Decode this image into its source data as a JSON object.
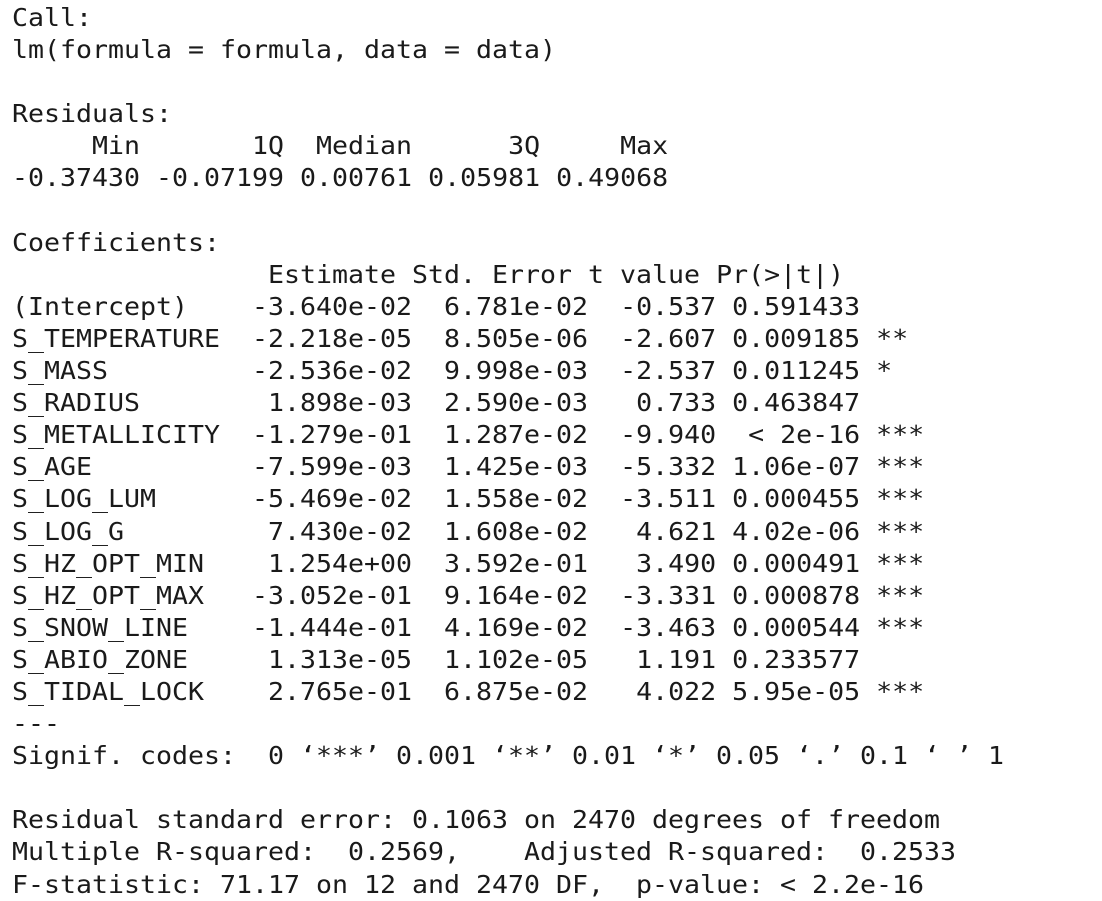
{
  "console": {
    "call_label": "Call:",
    "call": "lm(formula = formula, data = data)",
    "residuals_label": "Residuals:",
    "residual_headers": [
      "Min",
      "1Q",
      "Median",
      "3Q",
      "Max"
    ],
    "residual_values": [
      "-0.37430",
      "-0.07199",
      "0.00761",
      "0.05981",
      "0.49068"
    ],
    "coefficients_label": "Coefficients:",
    "coef_headers": [
      "Estimate",
      "Std. Error",
      "t value",
      "Pr(>|t|)"
    ],
    "coef_rows": [
      {
        "term": "(Intercept)",
        "estimate": "-3.640e-02",
        "std_error": "6.781e-02",
        "t_value": "-0.537",
        "p_value": "0.591433",
        "signif": ""
      },
      {
        "term": "S_TEMPERATURE",
        "estimate": "-2.218e-05",
        "std_error": "8.505e-06",
        "t_value": "-2.607",
        "p_value": "0.009185",
        "signif": "**"
      },
      {
        "term": "S_MASS",
        "estimate": "-2.536e-02",
        "std_error": "9.998e-03",
        "t_value": "-2.537",
        "p_value": "0.011245",
        "signif": "*"
      },
      {
        "term": "S_RADIUS",
        "estimate": "1.898e-03",
        "std_error": "2.590e-03",
        "t_value": "0.733",
        "p_value": "0.463847",
        "signif": ""
      },
      {
        "term": "S_METALLICITY",
        "estimate": "-1.279e-01",
        "std_error": "1.287e-02",
        "t_value": "-9.940",
        "p_value": "< 2e-16",
        "signif": "***"
      },
      {
        "term": "S_AGE",
        "estimate": "-7.599e-03",
        "std_error": "1.425e-03",
        "t_value": "-5.332",
        "p_value": "1.06e-07",
        "signif": "***"
      },
      {
        "term": "S_LOG_LUM",
        "estimate": "-5.469e-02",
        "std_error": "1.558e-02",
        "t_value": "-3.511",
        "p_value": "0.000455",
        "signif": "***"
      },
      {
        "term": "S_LOG_G",
        "estimate": "7.430e-02",
        "std_error": "1.608e-02",
        "t_value": "4.621",
        "p_value": "4.02e-06",
        "signif": "***"
      },
      {
        "term": "S_HZ_OPT_MIN",
        "estimate": "1.254e+00",
        "std_error": "3.592e-01",
        "t_value": "3.490",
        "p_value": "0.000491",
        "signif": "***"
      },
      {
        "term": "S_HZ_OPT_MAX",
        "estimate": "-3.052e-01",
        "std_error": "9.164e-02",
        "t_value": "-3.331",
        "p_value": "0.000878",
        "signif": "***"
      },
      {
        "term": "S_SNOW_LINE",
        "estimate": "-1.444e-01",
        "std_error": "4.169e-02",
        "t_value": "-3.463",
        "p_value": "0.000544",
        "signif": "***"
      },
      {
        "term": "S_ABIO_ZONE",
        "estimate": "1.313e-05",
        "std_error": "1.102e-05",
        "t_value": "1.191",
        "p_value": "0.233577",
        "signif": ""
      },
      {
        "term": "S_TIDAL_LOCK",
        "estimate": "2.765e-01",
        "std_error": "6.875e-02",
        "t_value": "4.022",
        "p_value": "5.95e-05",
        "signif": "***"
      }
    ],
    "separator": "---",
    "signif_codes": "Signif. codes:  0 ‘***’ 0.001 ‘**’ 0.01 ‘*’ 0.05 ‘.’ 0.1 ‘ ’ 1",
    "residual_se": "Residual standard error: 0.1063 on 2470 degrees of freedom",
    "r_squared": "Multiple R-squared:  0.2569,\tAdjusted R-squared:  0.2533",
    "f_statistic": "F-statistic: 71.17 on 12 and 2470 DF,  p-value: < 2.2e-16"
  }
}
